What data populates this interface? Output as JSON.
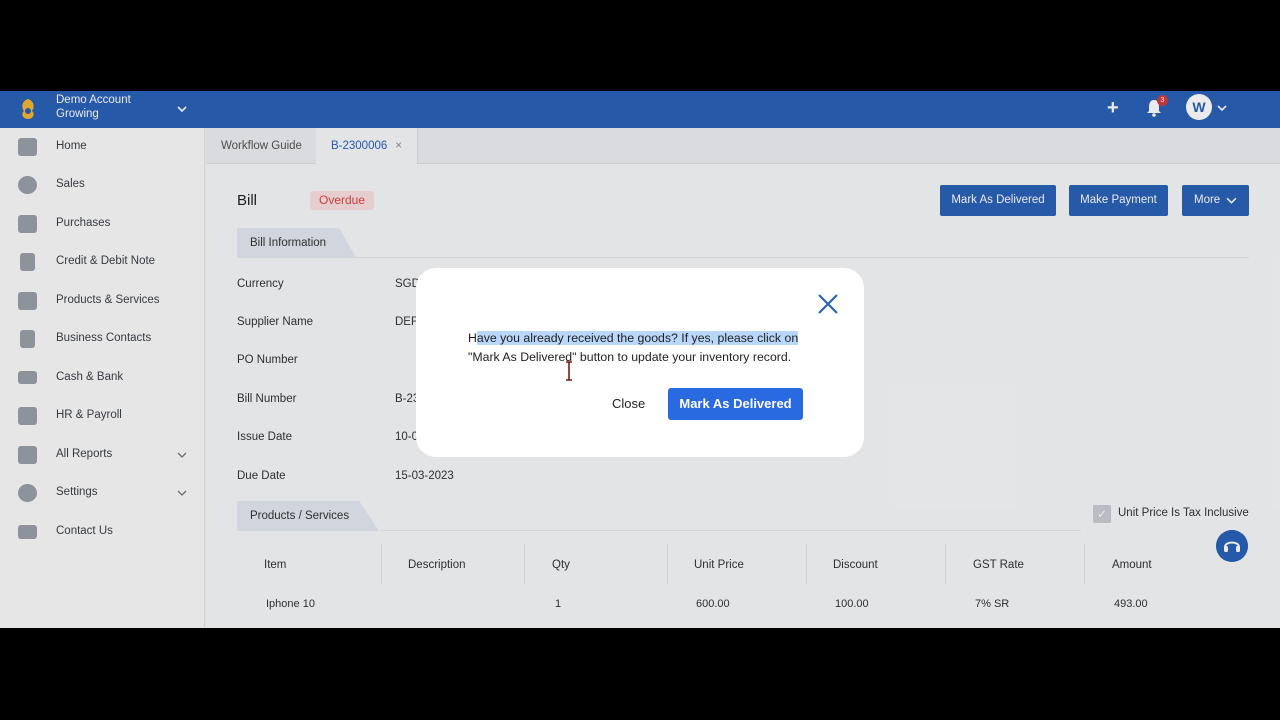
{
  "header": {
    "account_name": "Demo Account",
    "account_plan": "Growing",
    "notification_count": "3",
    "avatar_initial": "W"
  },
  "sidebar": {
    "items": [
      {
        "label": "Home",
        "icon": "home-icon"
      },
      {
        "label": "Sales",
        "icon": "dollar-icon"
      },
      {
        "label": "Purchases",
        "icon": "purchases-icon"
      },
      {
        "label": "Credit & Debit Note",
        "icon": "document-icon"
      },
      {
        "label": "Products & Services",
        "icon": "stack-icon"
      },
      {
        "label": "Business Contacts",
        "icon": "contact-book-icon"
      },
      {
        "label": "Cash & Bank",
        "icon": "cash-icon"
      },
      {
        "label": "HR & Payroll",
        "icon": "hr-icon"
      },
      {
        "label": "All Reports",
        "icon": "report-icon"
      },
      {
        "label": "Settings",
        "icon": "gear-icon"
      },
      {
        "label": "Contact Us",
        "icon": "id-card-icon"
      }
    ]
  },
  "tabs": [
    {
      "label": "Workflow Guide"
    },
    {
      "label": "B-2300006",
      "close": "×"
    }
  ],
  "bill": {
    "title": "Bill",
    "status": "Overdue",
    "actions": {
      "mark_delivered": "Mark As Delivered",
      "make_payment": "Make Payment",
      "more": "More"
    },
    "info_section": "Bill Information",
    "fields": [
      {
        "label": "Currency",
        "value": "SGD"
      },
      {
        "label": "Supplier Name",
        "value": "DEF"
      },
      {
        "label": "PO Number",
        "value": ""
      },
      {
        "label": "Bill Number",
        "value": "B-23"
      },
      {
        "label": "Issue Date",
        "value": "10-0"
      },
      {
        "label": "Due Date",
        "value": "15-03-2023"
      }
    ],
    "products_section": "Products / Services",
    "tax_inclusive_label": "Unit Price Is Tax Inclusive",
    "table": {
      "headers": [
        "Item",
        "Description",
        "Qty",
        "Unit Price",
        "Discount",
        "GST Rate",
        "Amount"
      ],
      "rows": [
        [
          "Iphone 10",
          "",
          "1",
          "600.00",
          "100.00",
          "7% SR",
          "493.00"
        ]
      ]
    }
  },
  "modal": {
    "message_selected": "Have you already received the goods? If yes, please click on",
    "message_first_char": "H",
    "message_rest": "\"Mark As Delivered\" button to update your inventory record.",
    "close_label": "Close",
    "confirm_label": "Mark As Delivered"
  },
  "colors": {
    "brand_blue": "#2a62b7",
    "overdue_red": "#d64545",
    "confirm_blue": "#2a6ae0"
  }
}
